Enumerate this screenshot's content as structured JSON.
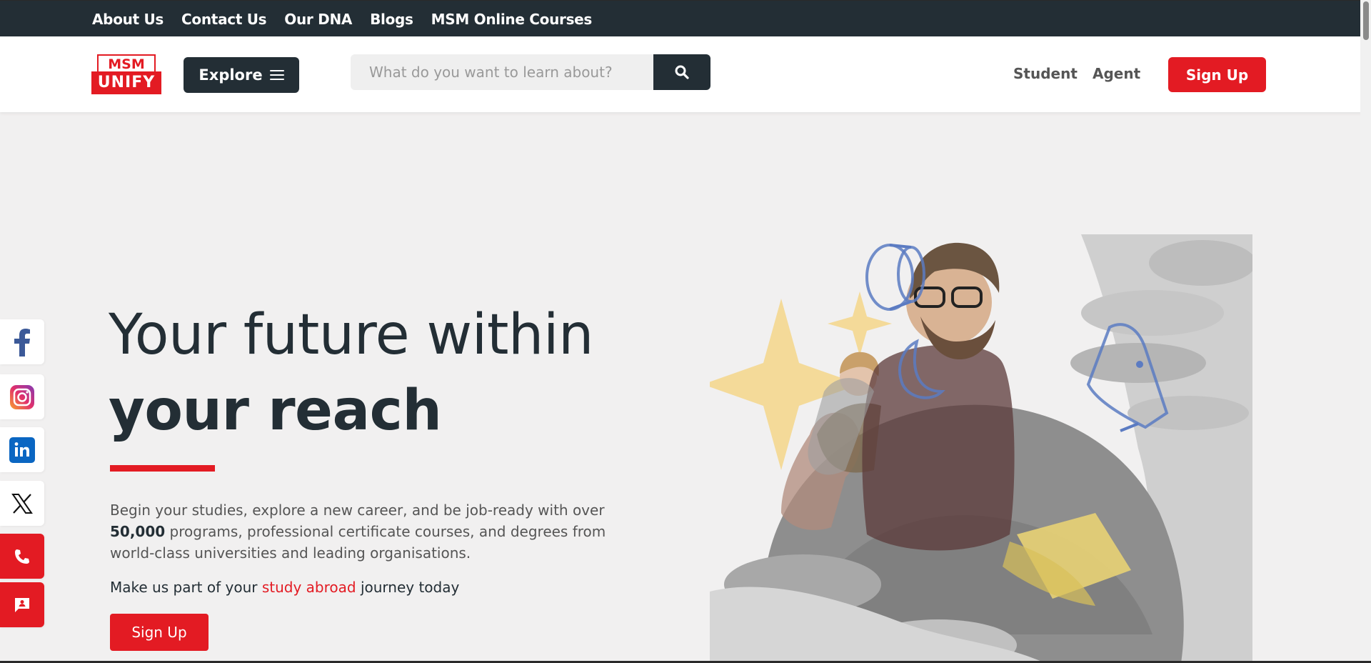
{
  "topbar": {
    "links": [
      "About Us",
      "Contact Us",
      "Our DNA",
      "Blogs",
      "MSM Online Courses"
    ]
  },
  "header": {
    "logo_top": "MSM",
    "logo_bottom": "UNIFY",
    "explore_label": "Explore",
    "search_placeholder": "What do you want to learn about?",
    "student_label": "Student",
    "agent_label": "Agent",
    "signup_label": "Sign Up"
  },
  "social": [
    "facebook-icon",
    "instagram-icon",
    "linkedin-icon",
    "x-icon",
    "phone-icon",
    "chat-icon"
  ],
  "hero": {
    "title_line1": "Your future within",
    "title_line2": "your reach",
    "desc_before": "Begin your studies, explore a new career, and be job-ready with over",
    "desc_bold": "50,000",
    "desc_after": " programs, professional certificate courses, and degrees from world-class universities and leading organisations.",
    "cta_before": "Make us part of your ",
    "cta_highlight": "study abroad",
    "cta_after": " journey today",
    "signup_label": "Sign Up"
  },
  "colors": {
    "brand_red": "#e31b23",
    "dark": "#232e35",
    "page_bg": "#f1f0f0"
  }
}
